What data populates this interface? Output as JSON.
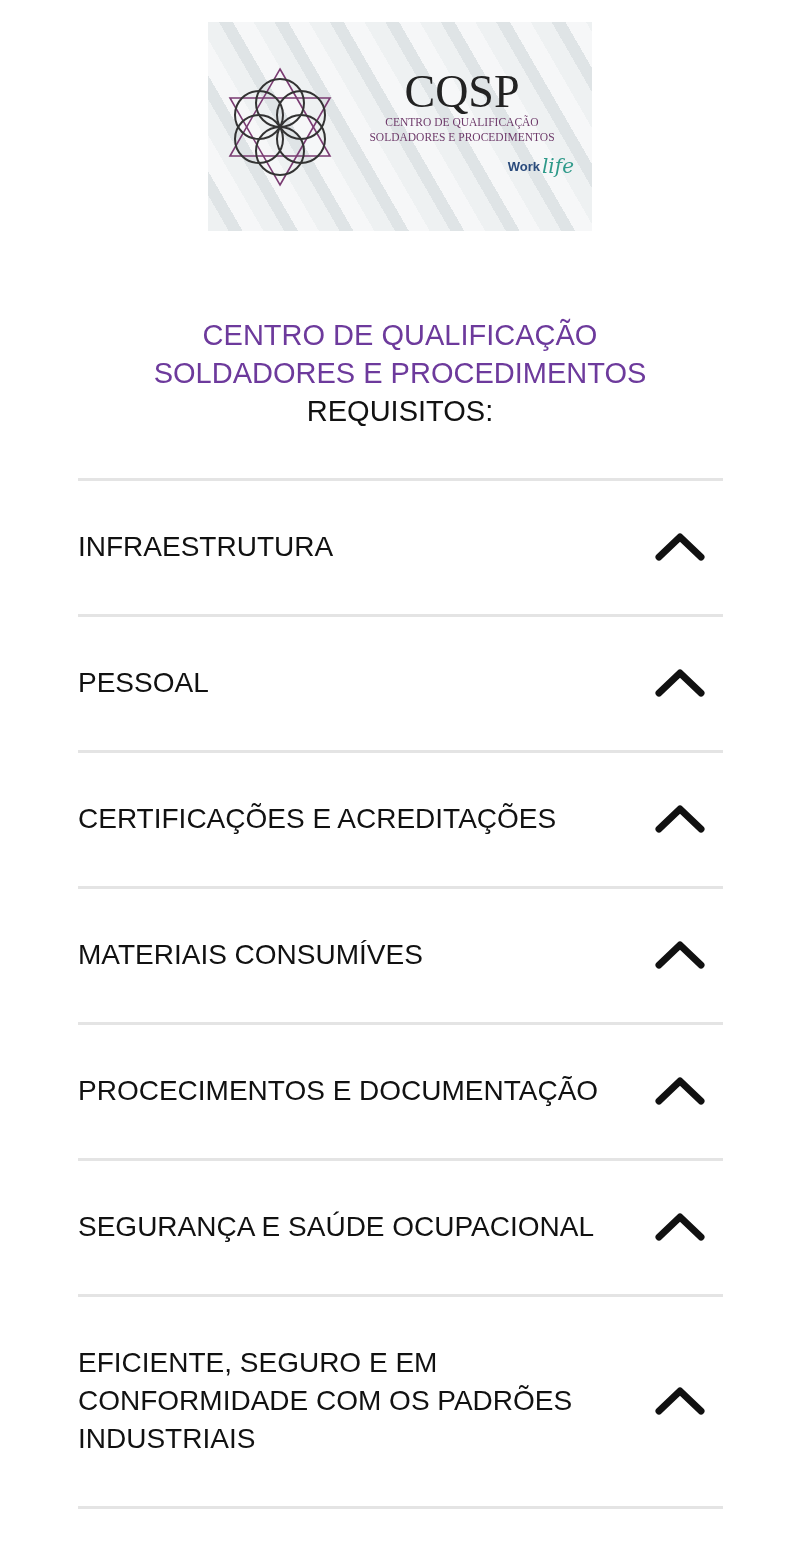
{
  "logo": {
    "acronym": "CQSP",
    "subtitle_lines": [
      "CENTRO DE QUALIFICAÇÃO",
      "SOLDADORES E PROCEDIMENTOS"
    ],
    "work": "Work",
    "life": "life"
  },
  "heading": {
    "title_lines": [
      "CENTRO DE QUALIFICAÇÃO",
      "SOLDADORES E PROCEDIMENTOS"
    ],
    "subtitle": "REQUISITOS:"
  },
  "accordion": [
    {
      "label": "INFRAESTRUTURA"
    },
    {
      "label": "PESSOAL"
    },
    {
      "label": "CERTIFICAÇÕES E ACREDITAÇÕES"
    },
    {
      "label": "MATERIAIS CONSUMÍVES"
    },
    {
      "label": "PROCECIMENTOS E DOCUMENTAÇÃO"
    },
    {
      "label": "SEGURANÇA E SAÚDE OCUPACIONAL"
    },
    {
      "label": "EFICIENTE, SEGURO E EM CONFORMIDADE COM OS PADRÕES INDUSTRIAIS"
    }
  ]
}
